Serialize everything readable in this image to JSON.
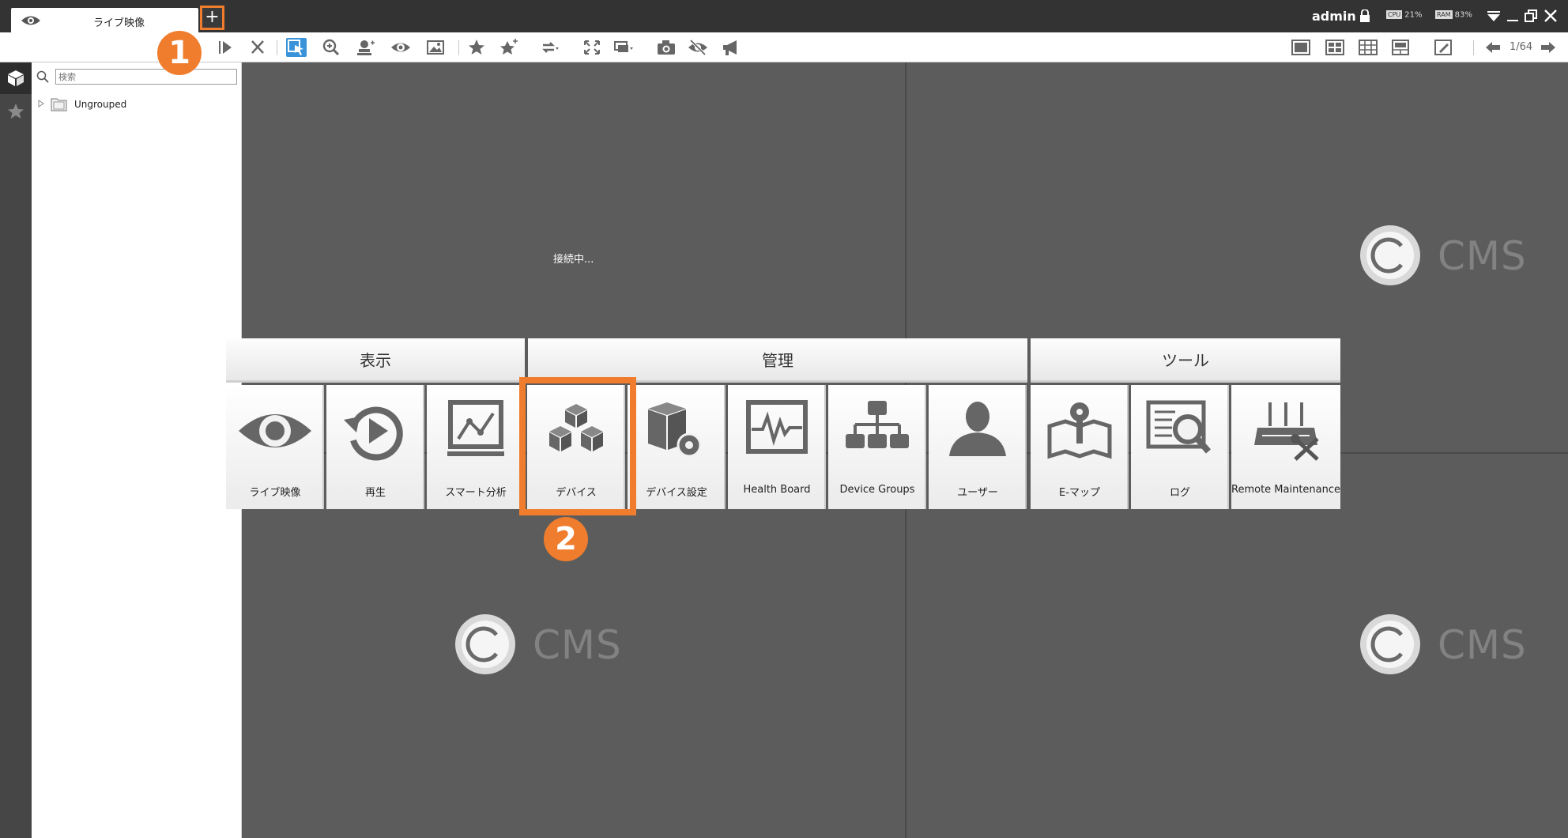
{
  "tab": {
    "label": "ライブ映像",
    "add_label": "+"
  },
  "header": {
    "user": "admin",
    "cpu_chip": "CPU",
    "cpu_value": "21%",
    "ram_chip": "RAM",
    "ram_value": "83%"
  },
  "toolbar": {
    "page_indicator": "1/64"
  },
  "tree": {
    "search_placeholder": "検索",
    "root_label": "Ungrouped"
  },
  "grid": {
    "connecting_text": "接続中...",
    "logo_text": "CMS"
  },
  "menu": {
    "sections": [
      {
        "label": "表示"
      },
      {
        "label": "管理"
      },
      {
        "label": "ツール"
      }
    ],
    "items": [
      {
        "label": "ライブ映像",
        "icon": "eye-icon"
      },
      {
        "label": "再生",
        "icon": "playback-icon"
      },
      {
        "label": "スマート分析",
        "icon": "smart-analysis-icon"
      },
      {
        "label": "デバイス",
        "icon": "devices-icon"
      },
      {
        "label": "デバイス設定",
        "icon": "device-settings-icon"
      },
      {
        "label": "Health Board",
        "icon": "health-board-icon"
      },
      {
        "label": "Device Groups",
        "icon": "device-groups-icon"
      },
      {
        "label": "ユーザー",
        "icon": "user-icon"
      },
      {
        "label": "E-マップ",
        "icon": "emap-icon"
      },
      {
        "label": "ログ",
        "icon": "log-icon"
      },
      {
        "label": "Remote Maintenance",
        "icon": "remote-maintenance-icon"
      }
    ]
  },
  "callouts": {
    "one": "1",
    "two": "2"
  },
  "colors": {
    "accent": "#ef7d2d",
    "titlebar": "#333333",
    "grid": "#5c5c5c",
    "selected_tool": "#3a93d9"
  }
}
